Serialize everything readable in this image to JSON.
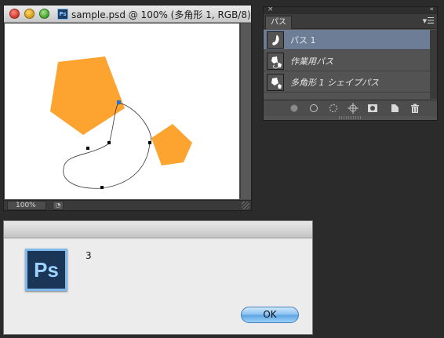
{
  "document_window": {
    "title": "sample.psd @ 100% (多角形 1, RGB/8)",
    "app_badge": "Ps",
    "zoom": "100%",
    "colors": {
      "shape_fill": "#fca330",
      "anchor_selected": "#2a6fd0"
    }
  },
  "paths_panel": {
    "tab_label": "パス",
    "menu_icon": "panel-menu-icon",
    "items": [
      {
        "label": "パス 1",
        "selected": true,
        "italic": false
      },
      {
        "label": "作業用パス",
        "selected": false,
        "italic": true
      },
      {
        "label": "多角形 1 シェイプパス",
        "selected": false,
        "italic": true
      }
    ],
    "footer_buttons": [
      "fill-path-icon",
      "stroke-path-icon",
      "load-selection-icon",
      "make-work-path-icon",
      "add-mask-icon",
      "new-path-icon",
      "trash-icon"
    ]
  },
  "alert": {
    "app_badge": "Ps",
    "message": "3",
    "ok_label": "OK"
  }
}
